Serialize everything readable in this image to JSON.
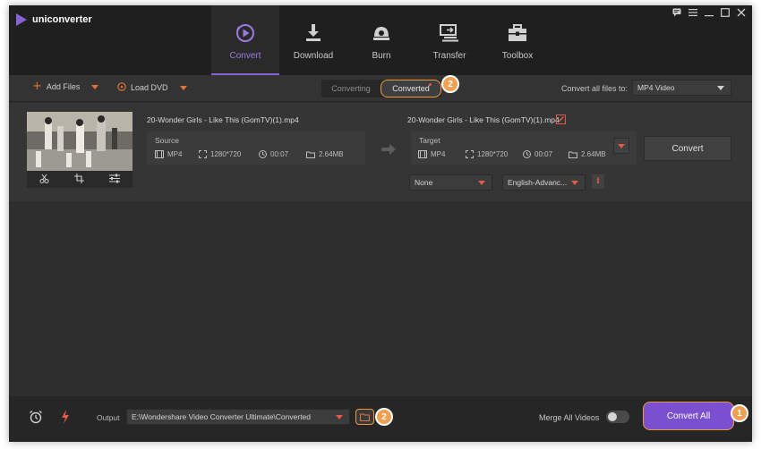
{
  "app": {
    "title": "uniconverter"
  },
  "nav": {
    "tabs": [
      {
        "label": "Convert",
        "icon": "convert-icon",
        "active": true
      },
      {
        "label": "Download",
        "icon": "download-icon",
        "active": false
      },
      {
        "label": "Burn",
        "icon": "burn-icon",
        "active": false
      },
      {
        "label": "Transfer",
        "icon": "transfer-icon",
        "active": false
      },
      {
        "label": "Toolbox",
        "icon": "toolbox-icon",
        "active": false
      }
    ]
  },
  "toolbar": {
    "add_files": "Add Files",
    "load_dvd": "Load DVD",
    "tabs": [
      "Converting",
      "Converted"
    ],
    "active_tab": "Converted",
    "convert_all_label": "Convert all files to:",
    "format_value": "MP4 Video"
  },
  "file": {
    "source_name": "20-Wonder Girls - Like This (GomTV)(1).mp4",
    "target_name": "20-Wonder Girls - Like This (GomTV)(1).mp4",
    "source": {
      "label": "Source",
      "format": "MP4",
      "resolution": "1280*720",
      "duration": "00:07",
      "size": "2.64MB"
    },
    "target": {
      "label": "Target",
      "format": "MP4",
      "resolution": "1280*720",
      "duration": "00:07",
      "size": "2.64MB"
    },
    "subtitle_value": "None",
    "audio_value": "English-Advanc...",
    "convert_label": "Convert"
  },
  "bottom": {
    "output_label": "Output",
    "output_path": "E:\\Wondershare Video Converter Ultimate\\Converted",
    "merge_label": "Merge All Videos",
    "merge_on": false,
    "convert_all_button": "Convert All"
  },
  "badges": {
    "converted_tab": "2",
    "folder": "2",
    "convert_all": "1"
  },
  "colors": {
    "accent": "#7a4fd0",
    "highlight": "#f09a3e",
    "warning": "#e2703a"
  }
}
